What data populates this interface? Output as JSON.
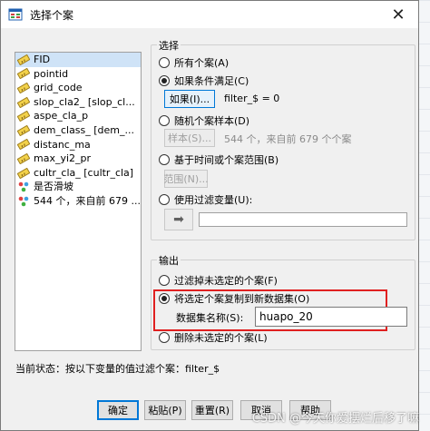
{
  "window": {
    "title": "选择个案",
    "close_glyph": "✕"
  },
  "variables": [
    {
      "label": "FID",
      "icon": "ruler-icon",
      "selected": true
    },
    {
      "label": "pointid",
      "icon": "ruler-icon"
    },
    {
      "label": "grid_code",
      "icon": "ruler-icon"
    },
    {
      "label": "slop_cla2_ [slop_cl...",
      "icon": "ruler-icon"
    },
    {
      "label": "aspe_cla_p",
      "icon": "ruler-icon"
    },
    {
      "label": "dem_class_ [dem_...",
      "icon": "ruler-icon"
    },
    {
      "label": "distanc_ma",
      "icon": "ruler-icon"
    },
    {
      "label": "max_yi2_pr",
      "icon": "ruler-icon"
    },
    {
      "label": "cultr_cla_ [cultr_cla]",
      "icon": "ruler-icon"
    },
    {
      "label": "是否滑坡",
      "icon": "nominal-icon"
    },
    {
      "label": "544 个，来自前 679 ...",
      "icon": "nominal-icon"
    }
  ],
  "select_group": {
    "legend": "选择",
    "all_cases": "所有个案(A)",
    "if_condition": "如果条件满足(C)",
    "if_button": "如果(I)...",
    "if_value": "filter_$ = 0",
    "random_sample": "随机个案样本(D)",
    "sample_button": "样本(S)...",
    "sample_value": "544 个，来自前 679 个个案",
    "time_range": "基于时间或个案范围(B)",
    "range_button": "范围(N)...",
    "filter_var": "使用过滤变量(U):",
    "arrow_glyph": "➡"
  },
  "output_group": {
    "legend": "输出",
    "filter_out": "过滤掉未选定的个案(F)",
    "copy_to_dataset": "将选定个案复制到新数据集(O)",
    "dataset_name_label": "数据集名称(S):",
    "dataset_name_value": "huapo_20",
    "delete_unselected": "删除未选定的个案(L)"
  },
  "status": "当前状态：按以下变量的值过滤个案：filter_$",
  "buttons": {
    "ok": "确定",
    "paste": "粘贴(P)",
    "reset": "重置(R)",
    "cancel": "取消",
    "help": "帮助"
  },
  "watermark": "CSDN @今天你爱摆烂后移了嘛"
}
